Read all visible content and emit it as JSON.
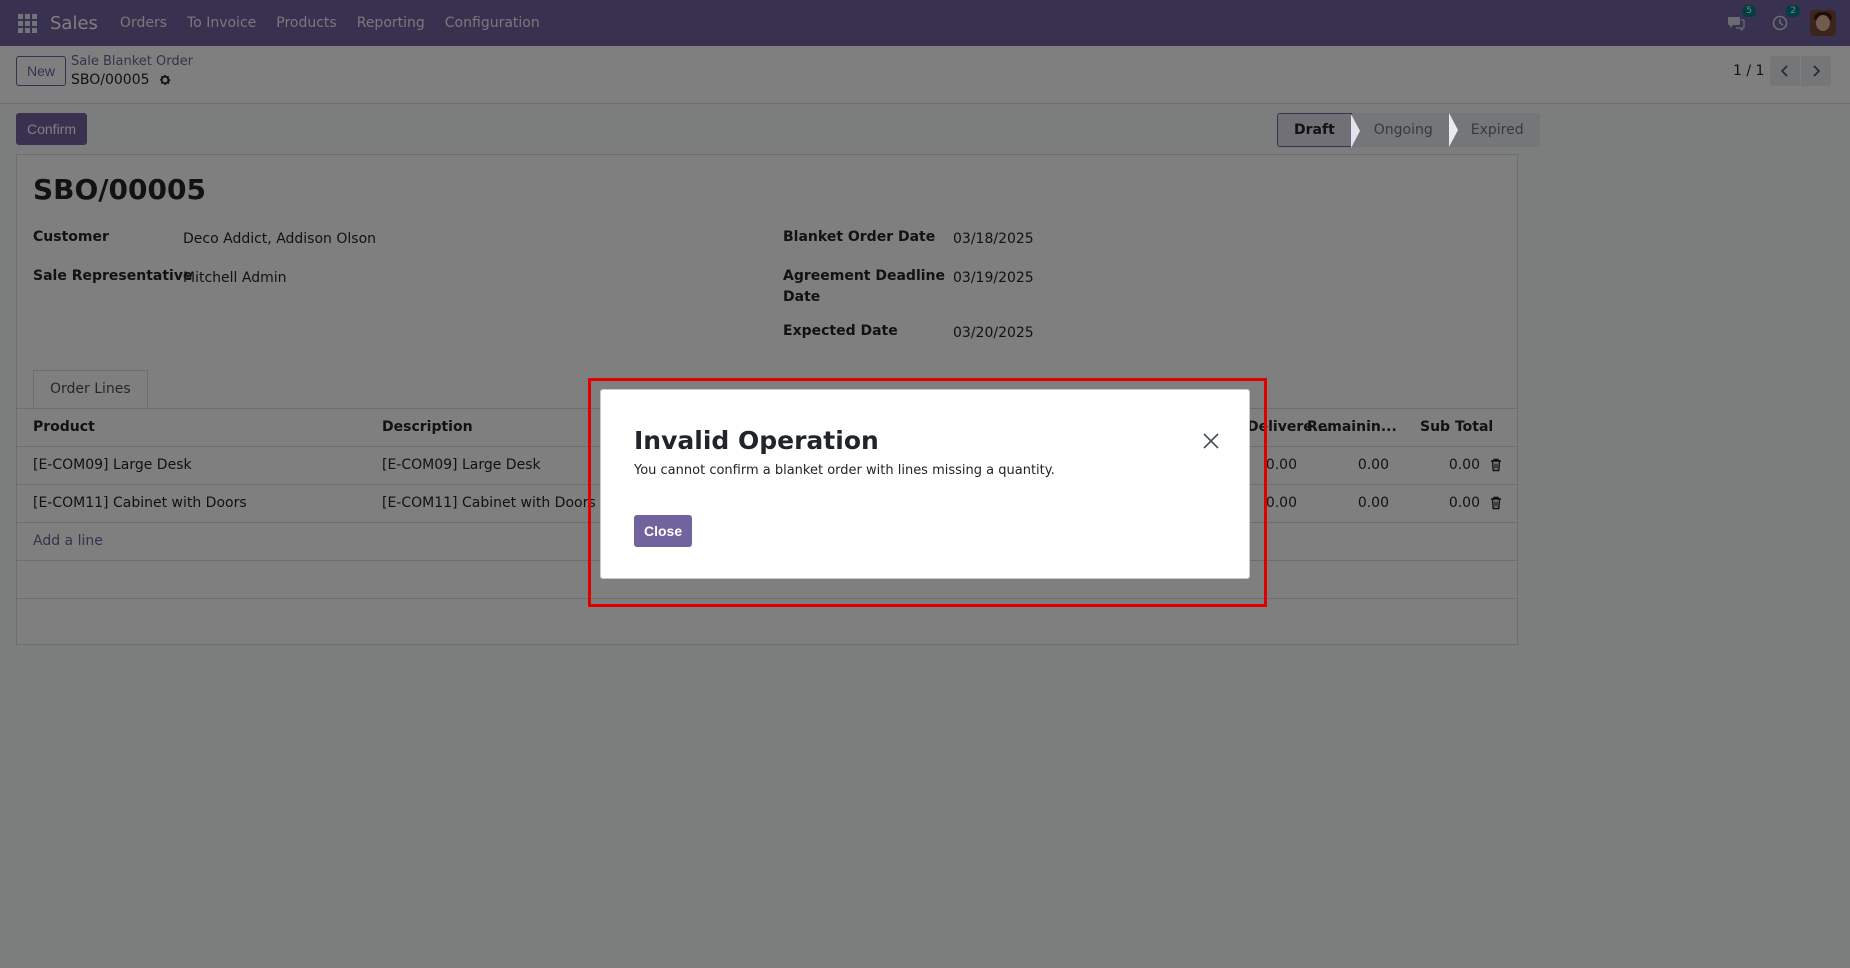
{
  "navbar": {
    "app_name": "Sales",
    "menu": [
      "Orders",
      "To Invoice",
      "Products",
      "Reporting",
      "Configuration"
    ],
    "messages_count": "5",
    "activities_count": "2"
  },
  "control_panel": {
    "new_label": "New",
    "breadcrumb_parent": "Sale Blanket Order",
    "breadcrumb_current": "SBO/00005",
    "pager": "1 / 1"
  },
  "actions": {
    "confirm_label": "Confirm"
  },
  "statusbar": {
    "steps": [
      "Draft",
      "Ongoing",
      "Expired"
    ],
    "active": "Draft"
  },
  "form": {
    "title": "SBO/00005",
    "customer_label": "Customer",
    "customer_value": "Deco Addict, Addison Olson",
    "salesrep_label": "Sale Representative",
    "salesrep_value": "Mitchell Admin",
    "order_date_label": "Blanket Order Date",
    "order_date_value": "03/18/2025",
    "deadline_label_1": "Agreement Deadline",
    "deadline_label_2": "Date",
    "deadline_value": "03/19/2025",
    "expected_label": "Expected Date",
    "expected_value": "03/20/2025"
  },
  "tabs": {
    "order_lines": "Order Lines"
  },
  "list": {
    "headers": {
      "product": "Product",
      "description": "Description",
      "delivered": "Delivere...",
      "remaining": "Remainin...",
      "subtotal": "Sub Total"
    },
    "rows": [
      {
        "product": "[E-COM09] Large Desk",
        "description": "[E-COM09] Large Desk",
        "delivered": "0.00",
        "remaining": "0.00",
        "subtotal": "0.00"
      },
      {
        "product": "[E-COM11] Cabinet with Doors",
        "description": "[E-COM11] Cabinet with Doors",
        "delivered": "0.00",
        "remaining": "0.00",
        "subtotal": "0.00"
      }
    ],
    "add_line": "Add a line"
  },
  "dialog": {
    "title": "Invalid Operation",
    "message": "You cannot confirm a blanket order with lines missing a quantity.",
    "close_label": "Close"
  },
  "colors": {
    "brand": "#71639e",
    "highlight": "#e00000"
  }
}
